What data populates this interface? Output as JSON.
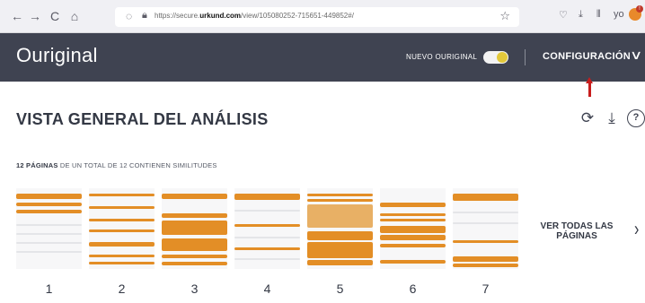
{
  "browser": {
    "back": "←",
    "forward": "→",
    "reload": "C",
    "home": "⌂",
    "url_prefix": "https://secure.",
    "url_domain": "urkund.com",
    "url_path": "/view/105080252-715651-449852#/",
    "star": "☆",
    "pocket": "♡",
    "download": "⤓",
    "library": "⫴",
    "profile": "yo"
  },
  "header": {
    "logo": "Ouriginal",
    "nuevo_label": "NUEVO OURIGINAL",
    "toggle_on": true,
    "config_label": "CONFIGURACIÓN",
    "config_chevron": "∨"
  },
  "analysis": {
    "title": "VISTA GENERAL DEL ANÁLISIS",
    "icons": [
      "refresh-icon",
      "download-icon",
      "help-icon"
    ],
    "refresh_glyph": "⟳",
    "download_glyph": "⤓",
    "help_glyph": "?",
    "summary_bold": "12 PÁGINAS",
    "summary_rest": " DE UN TOTAL DE 12 CONTIENEN SIMILITUDES",
    "pages": [
      "1",
      "2",
      "3",
      "4",
      "5",
      "6",
      "7"
    ],
    "ver_todas": "VER TODAS LAS PÁGINAS",
    "ver_chevron": "›"
  },
  "colors": {
    "header_bg": "#3f4351",
    "highlight": "#e38e26",
    "highlight_light": "#e8b065",
    "toggle_knob": "#e2c83a",
    "annotation_arrow": "#c81d1d"
  }
}
